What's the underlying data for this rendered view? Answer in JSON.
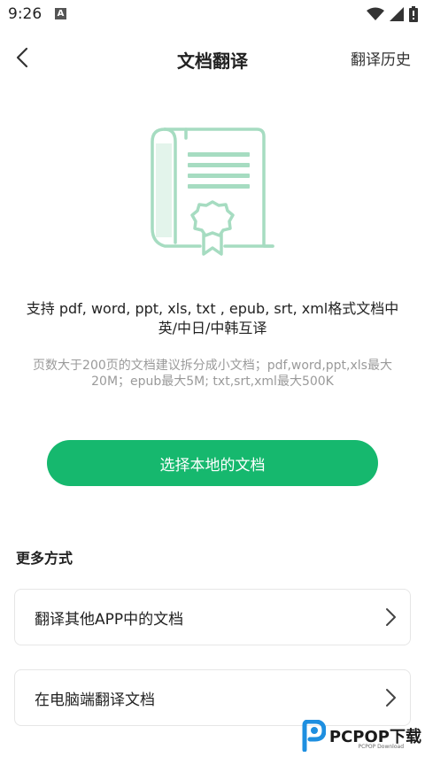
{
  "status_bar": {
    "time": "9:26",
    "notification_letter": "A"
  },
  "nav": {
    "title": "文档翻译",
    "history_label": "翻译历史"
  },
  "content": {
    "support_text": "支持 pdf, word, ppt, xls, txt , epub, srt, xml格式文档中英/中日/中韩互译",
    "limit_text": "页数大于200页的文档建议拆分成小文档；pdf,word,ppt,xls最大20M；epub最大5M; txt,srt,xml最大500K",
    "primary_button": "选择本地的文档"
  },
  "more": {
    "title": "更多方式",
    "options": [
      {
        "label": "翻译其他APP中的文档"
      },
      {
        "label": "在电脑端翻译文档"
      }
    ]
  },
  "watermark": {
    "brand": "PCPOP下载",
    "sub": "PCPOP Download"
  },
  "colors": {
    "accent": "#16b86e",
    "illustration": "#a6dcc1"
  }
}
